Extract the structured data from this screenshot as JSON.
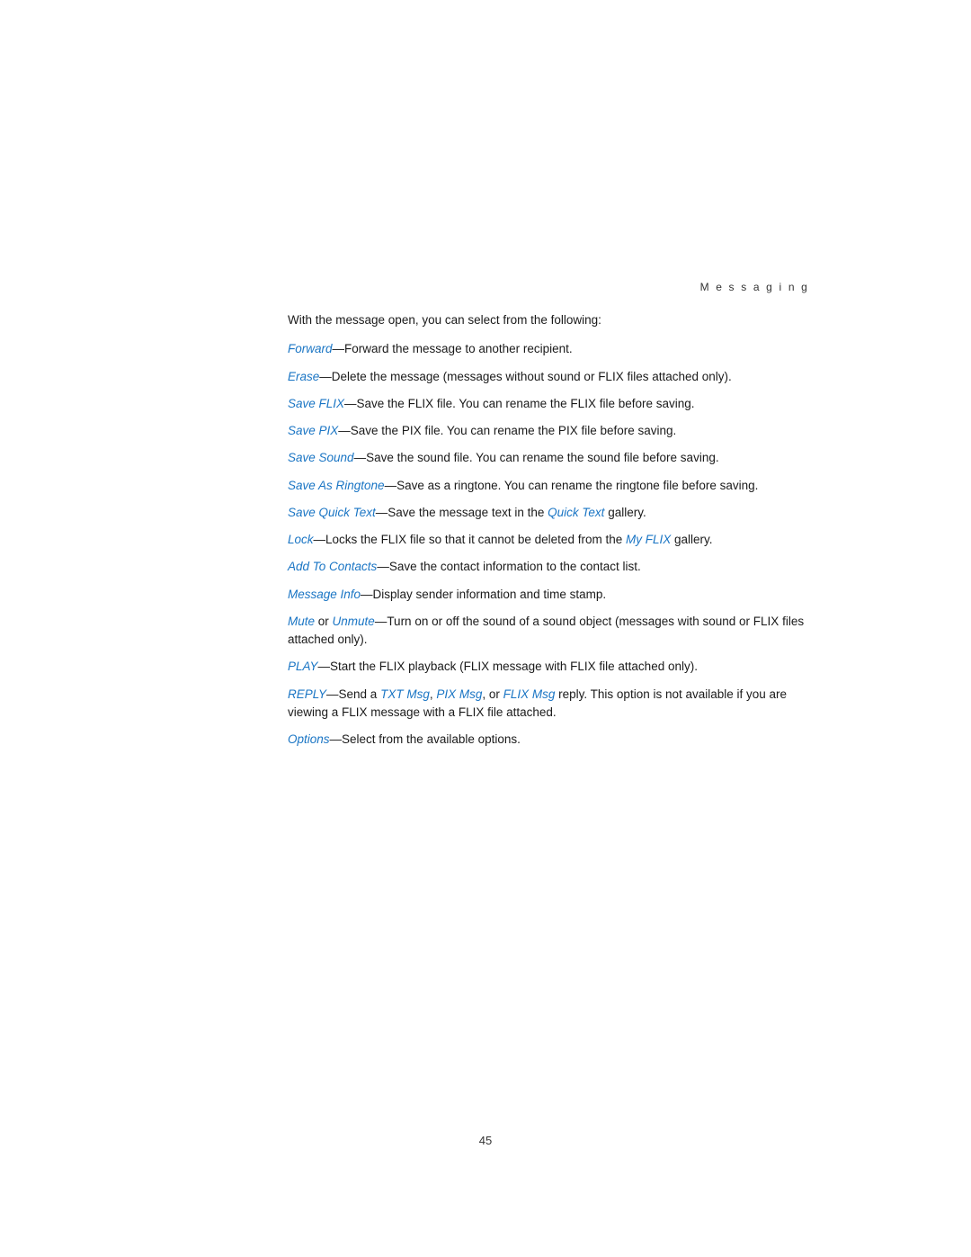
{
  "header": {
    "title": "M e s s a g i n g"
  },
  "intro": "With the message open, you can select from the following:",
  "menu_items": [
    {
      "id": "forward",
      "link": "Forward",
      "description": "—Forward the message to another recipient."
    },
    {
      "id": "erase",
      "link": "Erase",
      "description": "—Delete the message (messages without sound or FLIX files attached only)."
    },
    {
      "id": "save-flix",
      "link": "Save FLIX",
      "description": "—Save the FLIX file. You can rename the FLIX file before saving."
    },
    {
      "id": "save-pix",
      "link": "Save PIX",
      "description": "—Save the PIX file. You can rename the PIX file before saving."
    },
    {
      "id": "save-sound",
      "link": "Save Sound",
      "description": "—Save the sound file. You can rename the sound file before saving."
    },
    {
      "id": "save-as-ringtone",
      "link": "Save As Ringtone",
      "description": "—Save as a ringtone. You can rename the ringtone file before saving."
    },
    {
      "id": "save-quick-text",
      "link": "Save Quick Text",
      "description_before": "—Save the message text in the ",
      "inline_link": "Quick Text",
      "description_after": " gallery.",
      "has_inline_link": true
    },
    {
      "id": "lock",
      "link": "Lock",
      "description_before": "—Locks the FLIX file so that it cannot be deleted from the ",
      "inline_link": "My FLIX",
      "description_after": " gallery.",
      "has_inline_link": true
    },
    {
      "id": "add-to-contacts",
      "link": "Add To Contacts",
      "description": "—Save the contact information to the contact list."
    },
    {
      "id": "message-info",
      "link": "Message Info",
      "description": "—Display sender information and time stamp."
    },
    {
      "id": "mute-unmute",
      "link_part1": "Mute",
      "link_connector": " or ",
      "link_part2": "Unmute",
      "description": "—Turn on or off the sound of a sound object (messages with sound or FLIX files attached only).",
      "has_dual_link": true
    },
    {
      "id": "play",
      "link": "PLAY",
      "description": "—Start the FLIX playback (FLIX message with FLIX file attached only)."
    },
    {
      "id": "reply",
      "link": "REPLY",
      "description_before": "—Send a ",
      "inline_links": [
        "TXT Msg",
        "PIX Msg",
        "FLIX Msg"
      ],
      "description_after": " reply. This option is not available if you are viewing a FLIX message with a FLIX file attached.",
      "has_multi_inline": true
    },
    {
      "id": "options",
      "link": "Options",
      "description": "—Select from the available options."
    }
  ],
  "page_number": "45"
}
